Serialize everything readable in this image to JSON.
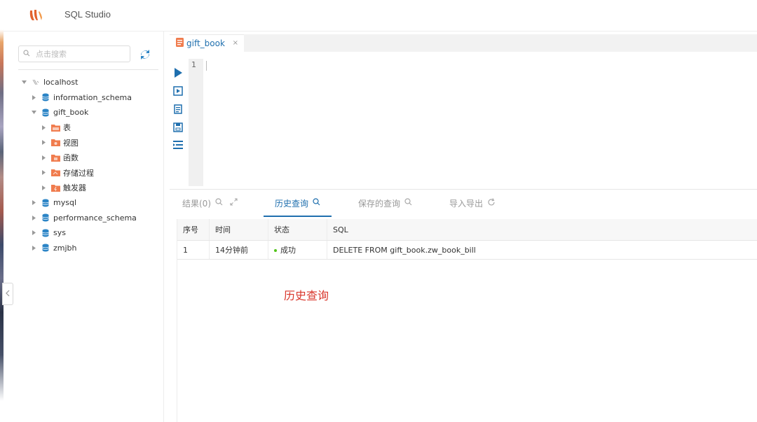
{
  "app": {
    "title": "SQL Studio"
  },
  "sidebar": {
    "search_placeholder": "点击搜索",
    "tree": {
      "root": "localhost",
      "databases": [
        {
          "name": "information_schema",
          "expanded": false
        },
        {
          "name": "gift_book",
          "expanded": true,
          "children": [
            "表",
            "视图",
            "函数",
            "存储过程",
            "触发器"
          ]
        },
        {
          "name": "mysql",
          "expanded": false
        },
        {
          "name": "performance_schema",
          "expanded": false
        },
        {
          "name": "sys",
          "expanded": false
        },
        {
          "name": "zmjbh",
          "expanded": false
        }
      ]
    }
  },
  "editor": {
    "tab_label": "gift_book",
    "tab_close": "×",
    "line_number": "1"
  },
  "result_tabs": {
    "results": "结果(0)",
    "history": "历史查询",
    "saved": "保存的查询",
    "import_export": "导入导出"
  },
  "history_table": {
    "headers": [
      "序号",
      "时间",
      "状态",
      "SQL"
    ],
    "rows": [
      {
        "index": "1",
        "time": "14分钟前",
        "status": "成功",
        "sql": "DELETE FROM gift_book.zw_book_bill"
      }
    ]
  },
  "annotation": "历史查询",
  "colors": {
    "accent": "#1f6fae",
    "folder": "#f07c4e",
    "db": "#2b84c6",
    "success": "#52c41a",
    "annotation": "#d9362b"
  }
}
